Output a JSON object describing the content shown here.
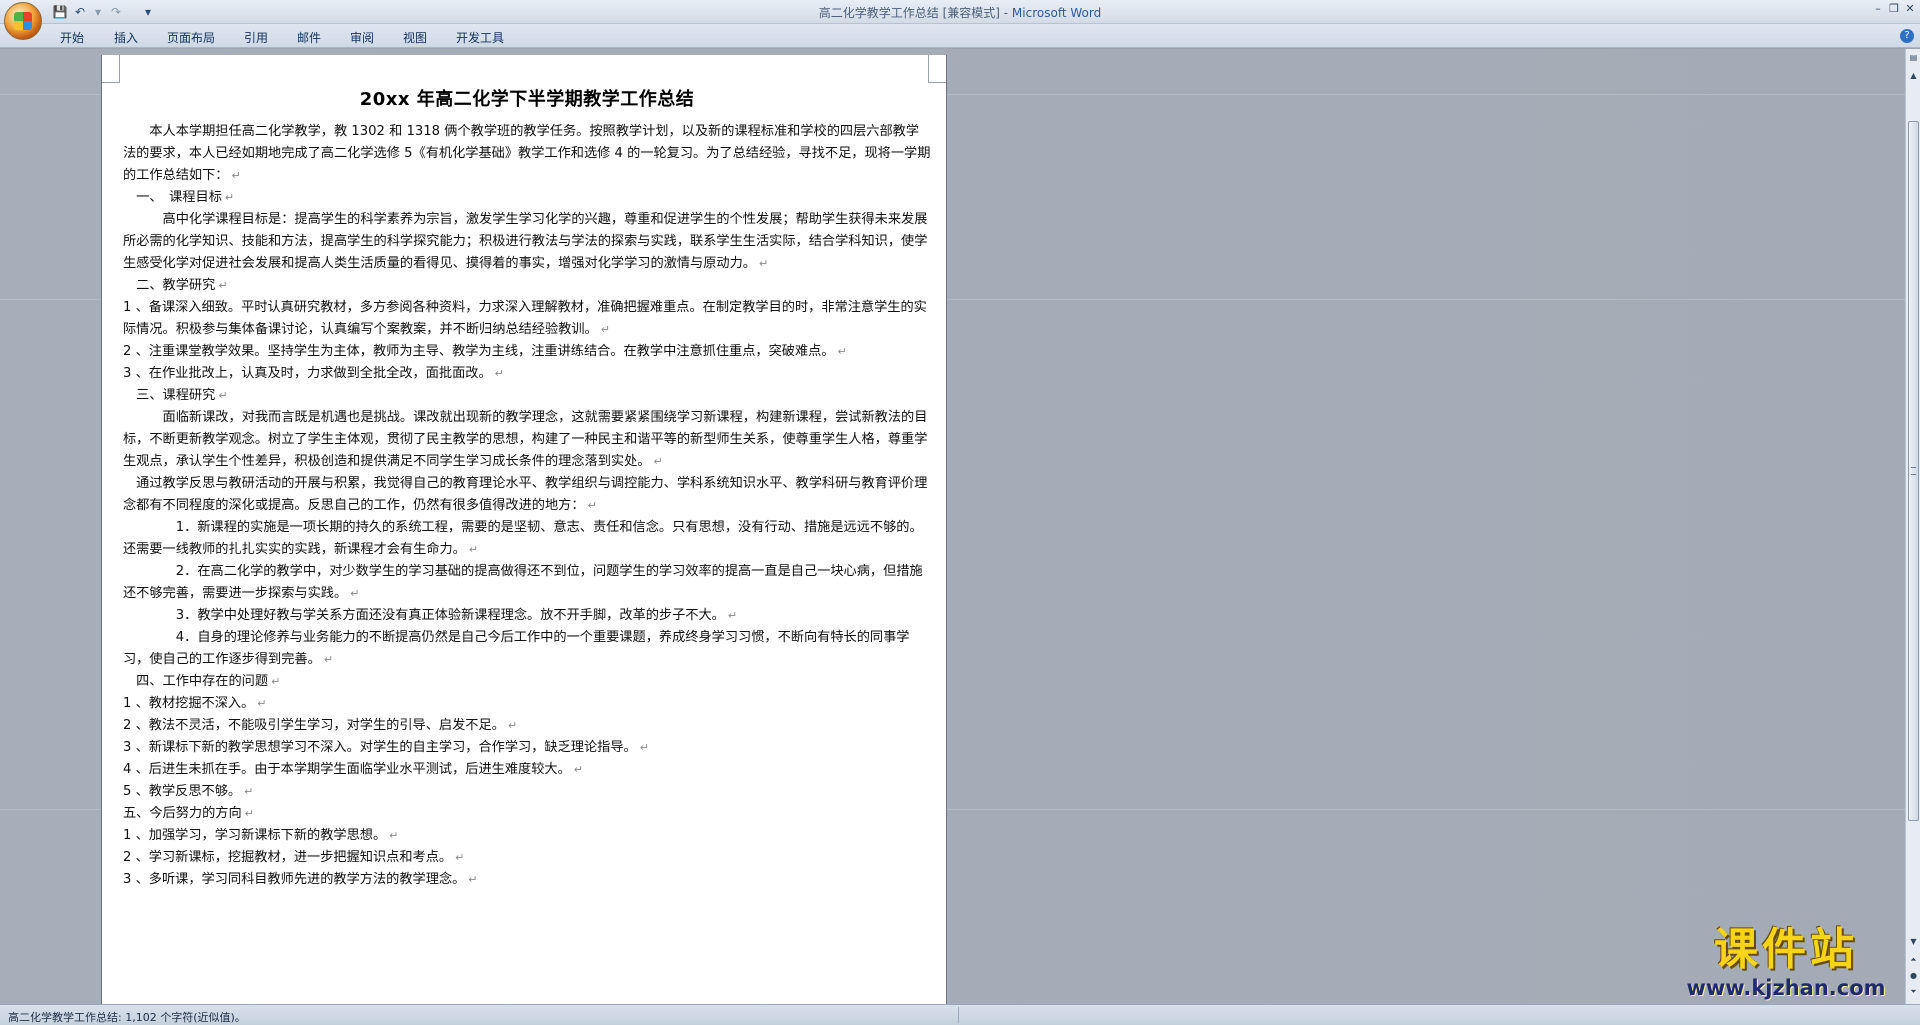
{
  "window": {
    "title": "高二化学教学工作总结 [兼容模式] - ",
    "app_name": "Microsoft Word"
  },
  "ribbon_tabs": [
    "开始",
    "插入",
    "页面布局",
    "引用",
    "邮件",
    "审阅",
    "视图",
    "开发工具"
  ],
  "document": {
    "heading": "20xx 年高二化学下半学期教学工作总结",
    "paragraphs": [
      "　　本人本学期担任高二化学教学，教 1302 和 1318 俩个教学班的教学任务。按照教学计划，以及新的课程标准和学校的四层六部教学法的要求，本人已经如期地完成了高二化学选修 5《有机化学基础》教学工作和选修 4 的一轮复习。为了总结经验，寻找不足，现将一学期的工作总结如下：",
      "　一、　课程目标",
      "　　　高中化学课程目标是：提高学生的科学素养为宗旨，激发学生学习化学的兴趣，尊重和促进学生的个性发展；帮助学生获得未来发展所必需的化学知识、技能和方法，提高学生的科学探究能力；积极进行教法与学法的探索与实践，联系学生生活实际，结合学科知识，使学生感受化学对促进社会发展和提高人类生活质量的看得见、摸得着的事实，增强对化学学习的激情与原动力。",
      "　二、教学研究",
      "1 、备课深入细致。平时认真研究教材，多方参阅各种资料，力求深入理解教材，准确把握难重点。在制定教学目的时，非常注意学生的实际情况。积极参与集体备课讨论，认真编写个案教案，并不断归纳总结经验教训。",
      "2 、注重课堂教学效果。坚持学生为主体，教师为主导、教学为主线，注重讲练结合。在教学中注意抓住重点，突破难点。",
      "3 、在作业批改上，认真及时，力求做到全批全改，面批面改。",
      "　三、课程研究",
      "　　　面临新课改，对我而言既是机遇也是挑战。课改就出现新的教学理念，这就需要紧紧围绕学习新课程，构建新课程，尝试新教法的目标，不断更新教学观念。树立了学生主体观，贯彻了民主教学的思想，构建了一种民主和谐平等的新型师生关系，使尊重学生人格，尊重学生观点，承认学生个性差异，积极创造和提供满足不同学生学习成长条件的理念落到实处。",
      "　通过教学反思与教研活动的开展与积累，我觉得自己的教育理论水平、教学组织与调控能力、学科系统知识水平、教学科研与教育评价理念都有不同程度的深化或提高。反思自己的工作，仍然有很多值得改进的地方：",
      "　　　　1．新课程的实施是一项长期的持久的系统工程，需要的是坚韧、意志、责任和信念。只有思想，没有行动、措施是远远不够的。还需要一线教师的扎扎实实的实践，新课程才会有生命力。",
      "　　　　2．在高二化学的教学中，对少数学生的学习基础的提高做得还不到位，问题学生的学习效率的提高一直是自己一块心病，但措施还不够完善，需要进一步探索与实践。",
      "　　　　3．教学中处理好教与学关系方面还没有真正体验新课程理念。放不开手脚，改革的步子不大。",
      "　　　　4．自身的理论修养与业务能力的不断提高仍然是自己今后工作中的一个重要课题，养成终身学习习惯，不断向有特长的同事学习，使自己的工作逐步得到完善。",
      "　四、工作中存在的问题",
      "1 、教材挖掘不深入。",
      "2 、教法不灵活，不能吸引学生学习，对学生的引导、启发不足。",
      "3 、新课标下新的教学思想学习不深入。对学生的自主学习，合作学习，缺乏理论指导。",
      "4 、后进生未抓在手。由于本学期学生面临学业水平测试，后进生难度较大。",
      "5 、教学反思不够。",
      "五、今后努力的方向",
      "1 、加强学习，学习新课标下新的教学思想。",
      "2 、学习新课标，挖掘教材，进一步把握知识点和考点。",
      "3 、多听课，学习同科目教师先进的教学方法的教学理念。"
    ]
  },
  "status_bar": {
    "text": "高二化学教学工作总结: 1,102 个字符(近似值)。"
  },
  "watermark": {
    "main": "课件站",
    "url": "www.kjzhan.com"
  },
  "icons": [
    "office-button-icon",
    "save-icon",
    "undo-icon",
    "redo-icon",
    "qat-dropdown-icon",
    "minimize-icon",
    "restore-icon",
    "close-icon",
    "help-icon",
    "scroll-up-icon",
    "scroll-down-icon",
    "prev-page-icon",
    "select-browse-object-icon",
    "next-page-icon",
    "paragraph-mark-icon"
  ],
  "colors": {
    "workspace": "#a6aeb9",
    "page": "#ffffff",
    "watermark_yellow": "#f6d417",
    "watermark_blue": "#1f2a6e",
    "app_name_blue": "#2c5aa0"
  }
}
